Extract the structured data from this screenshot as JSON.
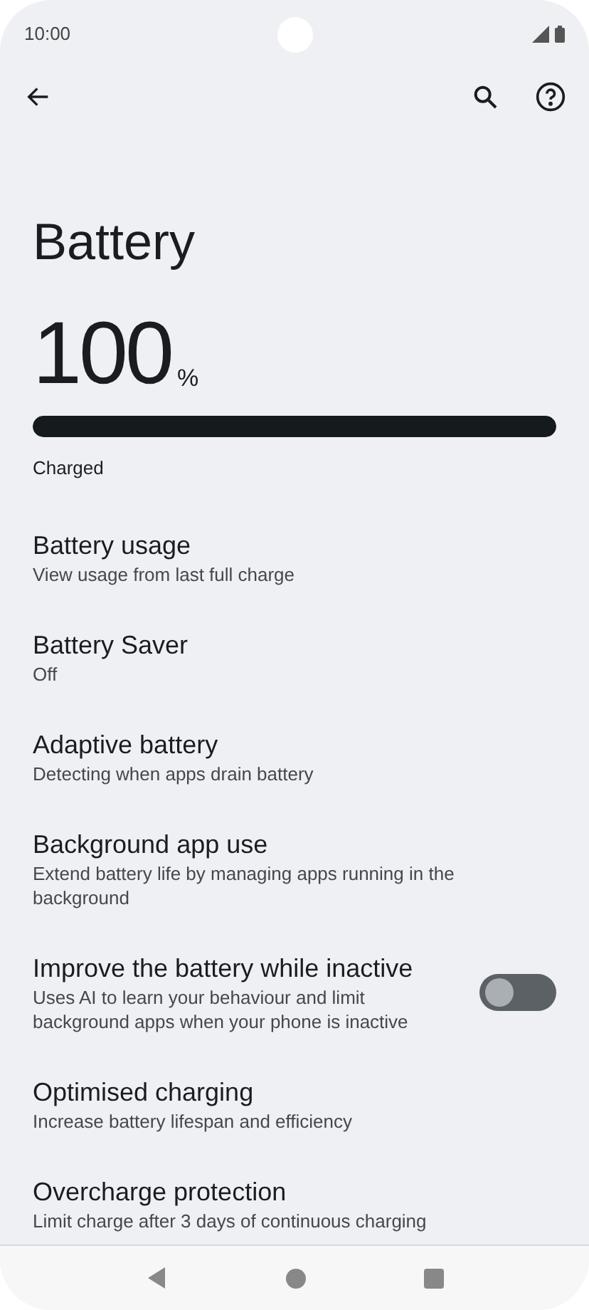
{
  "status_bar": {
    "time": "10:00"
  },
  "title": "Battery",
  "battery": {
    "value": "100",
    "unit": "%",
    "level": 1,
    "status": "Charged"
  },
  "items": [
    {
      "kind": "plain",
      "title": "Battery usage",
      "subtitle": "View usage from last full charge"
    },
    {
      "kind": "plain",
      "title": "Battery Saver",
      "subtitle": "Off"
    },
    {
      "kind": "plain",
      "title": "Adaptive battery",
      "subtitle": "Detecting when apps drain battery"
    },
    {
      "kind": "plain",
      "title": "Background app use",
      "subtitle": "Extend battery life by managing apps running in the background"
    },
    {
      "kind": "switch",
      "title": "Improve the battery while inactive",
      "subtitle": "Uses AI to learn your behaviour and limit background apps when your phone is inactive",
      "on": false
    },
    {
      "kind": "plain",
      "title": "Optimised charging",
      "subtitle": "Increase battery lifespan and efficiency"
    },
    {
      "kind": "plain",
      "title": "Overcharge protection",
      "subtitle": "Limit charge after 3 days of continuous charging"
    }
  ]
}
